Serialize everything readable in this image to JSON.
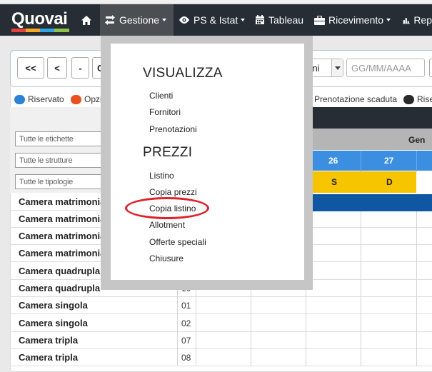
{
  "top_strip": {
    "text": ""
  },
  "brand": {
    "name": "Quovai",
    "bar_colors": [
      "#e8413c",
      "#f5a623",
      "#2fa4e7",
      "#8bc34a"
    ]
  },
  "nav": {
    "items": [
      {
        "label": "",
        "icon": "home-icon"
      },
      {
        "label": "Gestione",
        "icon": "exchange-icon",
        "active": true,
        "dropdown": true
      },
      {
        "label": "PS & Istat",
        "icon": "eye-icon",
        "dropdown": true
      },
      {
        "label": "Tableau",
        "icon": "calendar-icon"
      },
      {
        "label": "Ricevimento",
        "icon": "briefcase-icon",
        "dropdown": true
      },
      {
        "label": "Rep",
        "icon": "bar-chart-icon"
      }
    ]
  },
  "toolbar": {
    "buttons": [
      "<<",
      "<",
      "-"
    ],
    "date_label": "Ogg",
    "days_select": "iorni",
    "date_placeholder": "GG/MM/AAAA"
  },
  "legend": [
    {
      "label": "Riservato",
      "color": "#2b82d6"
    },
    {
      "label": "Opzion",
      "color": "#e8531f"
    },
    {
      "label": "Prenotazione scaduta",
      "color": "#8b0e12"
    },
    {
      "label": "Riser",
      "color": "#2a2a2a"
    }
  ],
  "filters": {
    "tags_placeholder": "Tutte le etichette",
    "structures_placeholder": "Tutte le strutture",
    "types_placeholder": "Tutte le tipologie"
  },
  "grid": {
    "month_label": "Gen",
    "days": [
      "26",
      "27"
    ],
    "weekdays": [
      "S",
      "D"
    ],
    "colors": {
      "header_dark": "#262d34",
      "day_row": "#3c8fe0",
      "weekday_row": "#f7c400",
      "booking": "#0f56a3"
    }
  },
  "rooms": [
    {
      "name": "Camera matrimoniale",
      "code": ""
    },
    {
      "name": "Camera matrimoniale",
      "code": ""
    },
    {
      "name": "Camera matrimoniale",
      "code": ""
    },
    {
      "name": "Camera matrimoniale",
      "code": ""
    },
    {
      "name": "Camera quadrupla",
      "code": ""
    },
    {
      "name": "Camera quadrupla",
      "code": "10"
    },
    {
      "name": "Camera singola",
      "code": "01"
    },
    {
      "name": "Camera singola",
      "code": "02"
    },
    {
      "name": "Camera tripla",
      "code": "07"
    },
    {
      "name": "Camera tripla",
      "code": "08"
    }
  ],
  "dropdown": {
    "sections": [
      {
        "heading": "VISUALIZZA",
        "items": [
          "Clienti",
          "Fornitori",
          "Prenotazioni"
        ]
      },
      {
        "heading": "PREZZI",
        "items": [
          "Listino",
          "Copia prezzi",
          "Copia listino",
          "Allotment",
          "Offerte speciali",
          "Chiusure"
        ]
      }
    ],
    "highlighted_item": "Copia listino",
    "highlight_color": "#e0202a"
  }
}
